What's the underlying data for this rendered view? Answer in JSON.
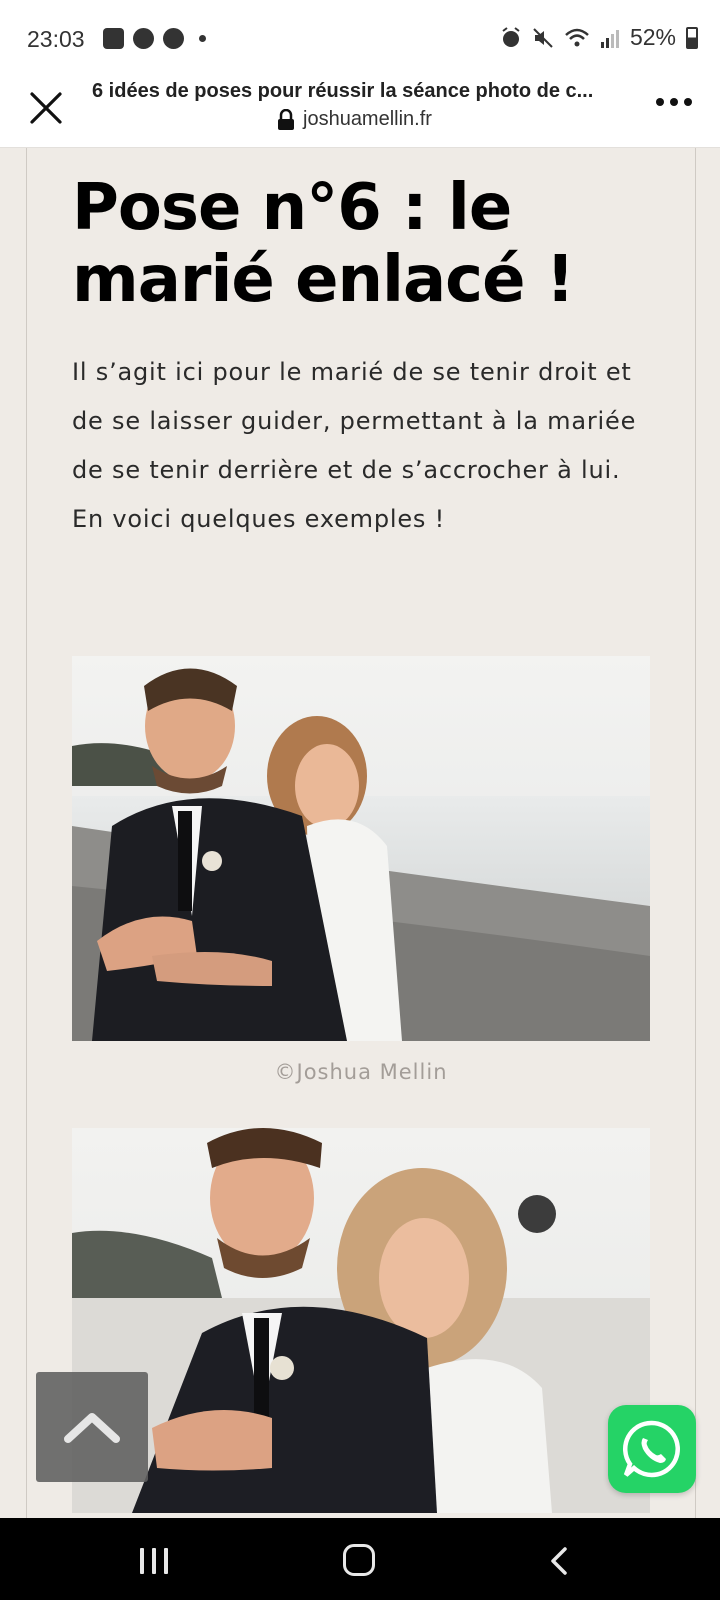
{
  "status_bar": {
    "time": "23:03",
    "left_icons": [
      "gallery-icon",
      "facebook-icon",
      "messenger-icon",
      "notification-dot"
    ],
    "right_icons": [
      "alarm-icon",
      "mute-icon",
      "wifi-icon",
      "signal-icon"
    ],
    "battery": "52%"
  },
  "browser": {
    "title": "6 idées de poses pour réussir la séance photo de c...",
    "url": "joshuamellin.fr",
    "icons": [
      "close-icon",
      "lock-icon",
      "more-options-icon"
    ]
  },
  "article": {
    "heading": "Pose n°6 : le marié enlacé !",
    "paragraph": "Il s’agit ici pour le marié de se tenir droit et de se laisser guider, permettant à la mariée de se tenir derrière et de s’accrocher à lui. En voici quelques exemples !",
    "photo_caption": "©Joshua Mellin"
  },
  "floating": {
    "scroll_top_icon": "chevron-up-icon",
    "chat_icon": "whatsapp-icon"
  },
  "nav_bar": {
    "icons": [
      "recent-apps-icon",
      "home-icon",
      "back-icon"
    ]
  },
  "colors": {
    "page_bg": "#efebe6",
    "heading": "#000000",
    "caption": "#a39d98",
    "whatsapp": "#25d366"
  }
}
